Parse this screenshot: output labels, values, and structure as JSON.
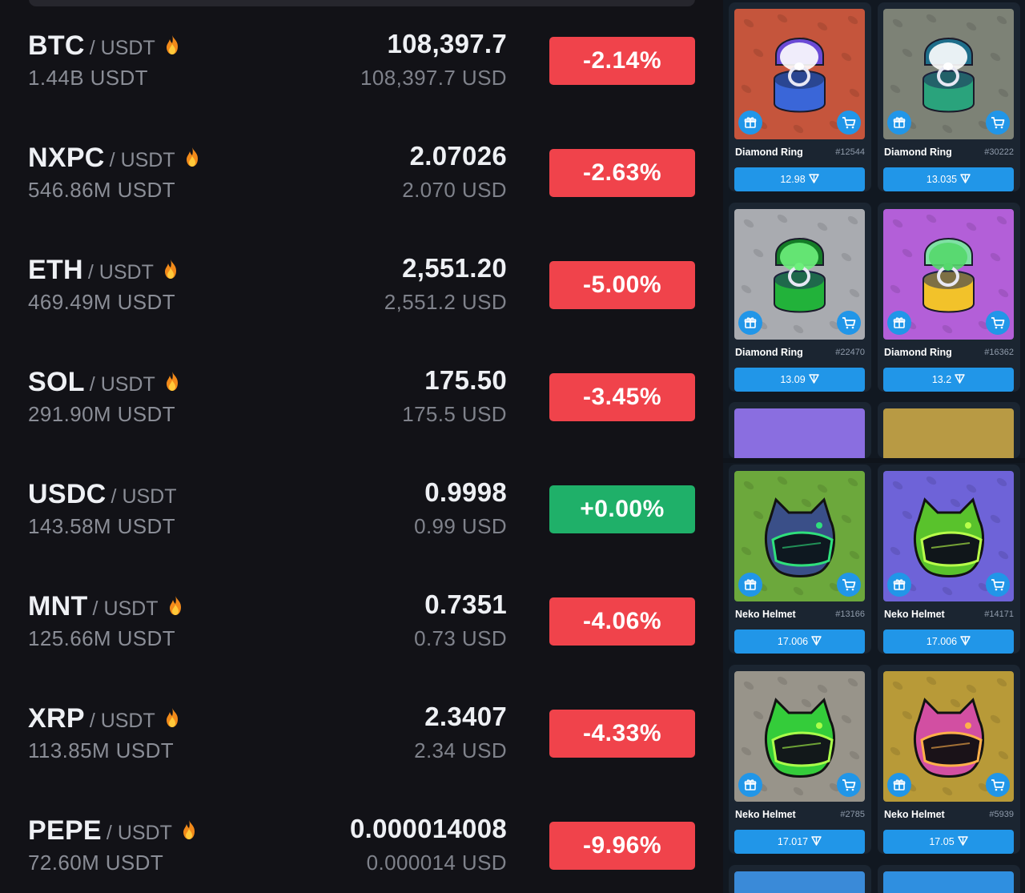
{
  "market": {
    "rows": [
      {
        "base": "BTC",
        "quote": "/ USDT",
        "hot": true,
        "volume": "1.44B USDT",
        "price": "108,397.7",
        "fiat": "108,397.7 USD",
        "change": "-2.14%",
        "direction": "down"
      },
      {
        "base": "NXPC",
        "quote": "/ USDT",
        "hot": true,
        "volume": "546.86M USDT",
        "price": "2.07026",
        "fiat": "2.070 USD",
        "change": "-2.63%",
        "direction": "down"
      },
      {
        "base": "ETH",
        "quote": "/ USDT",
        "hot": true,
        "volume": "469.49M USDT",
        "price": "2,551.20",
        "fiat": "2,551.2 USD",
        "change": "-5.00%",
        "direction": "down"
      },
      {
        "base": "SOL",
        "quote": "/ USDT",
        "hot": true,
        "volume": "291.90M USDT",
        "price": "175.50",
        "fiat": "175.5 USD",
        "change": "-3.45%",
        "direction": "down"
      },
      {
        "base": "USDC",
        "quote": "/ USDT",
        "hot": false,
        "volume": "143.58M USDT",
        "price": "0.9998",
        "fiat": "0.99 USD",
        "change": "+0.00%",
        "direction": "up"
      },
      {
        "base": "MNT",
        "quote": "/ USDT",
        "hot": true,
        "volume": "125.66M USDT",
        "price": "0.7351",
        "fiat": "0.73 USD",
        "change": "-4.06%",
        "direction": "down"
      },
      {
        "base": "XRP",
        "quote": "/ USDT",
        "hot": true,
        "volume": "113.85M USDT",
        "price": "2.3407",
        "fiat": "2.34 USD",
        "change": "-4.33%",
        "direction": "down"
      },
      {
        "base": "PEPE",
        "quote": "/ USDT",
        "hot": true,
        "volume": "72.60M USDT",
        "price": "0.000014008",
        "fiat": "0.000014 USD",
        "change": "-9.96%",
        "direction": "down"
      }
    ],
    "colors": {
      "down": "#f0434b",
      "up": "#1fb069",
      "background": "#121217"
    }
  },
  "nft": {
    "cards": [
      {
        "name": "Diamond Ring",
        "number": "#12544",
        "price": "12.98",
        "item": "ring",
        "bg": "#c5553c",
        "box": "#3a66d8",
        "lid": "#6b4bd6",
        "gem": "#ffffff"
      },
      {
        "name": "Diamond Ring",
        "number": "#30222",
        "price": "13.035",
        "item": "ring",
        "bg": "#7d8276",
        "box": "#2aa37c",
        "lid": "#1e6e8a",
        "gem": "#ffffff"
      },
      {
        "name": "Diamond Ring",
        "number": "#22470",
        "price": "13.09",
        "item": "ring",
        "bg": "#a9abb0",
        "box": "#22b23a",
        "lid": "#147c26",
        "gem": "#6df07c"
      },
      {
        "name": "Diamond Ring",
        "number": "#16362",
        "price": "13.2",
        "item": "ring",
        "bg": "#b35fd8",
        "box": "#f2c22a",
        "lid": "#7fe0a4",
        "gem": "#55d86c"
      },
      {
        "name": "Neko Helmet",
        "number": "#13166",
        "price": "17.006",
        "item": "helmet",
        "bg": "#6ca83c",
        "helmet": "#3a4f88",
        "visor": "#0e1820",
        "glow": "#2fe07c"
      },
      {
        "name": "Neko Helmet",
        "number": "#14171",
        "price": "17.006",
        "item": "helmet",
        "bg": "#6e63d8",
        "helmet": "#59c22c",
        "visor": "#10161a",
        "glow": "#b8ff4a"
      },
      {
        "name": "Neko Helmet",
        "number": "#2785",
        "price": "17.017",
        "item": "helmet",
        "bg": "#98948a",
        "helmet": "#34cc3a",
        "visor": "#12181a",
        "glow": "#aaff4a"
      },
      {
        "name": "Neko Helmet",
        "number": "#5939",
        "price": "17.05",
        "item": "helmet",
        "bg": "#b89a38",
        "helmet": "#d24fa2",
        "visor": "#1a1218",
        "glow": "#ffb04a"
      }
    ],
    "peeks": [
      {
        "bg": "#8a6ee0"
      },
      {
        "bg": "#b89a44"
      },
      {
        "bg": "#3a8ad8"
      },
      {
        "bg": "#2f8fe0"
      }
    ],
    "colors": {
      "button": "#2196e8",
      "card": "#1b2531",
      "background": "#111821"
    }
  }
}
